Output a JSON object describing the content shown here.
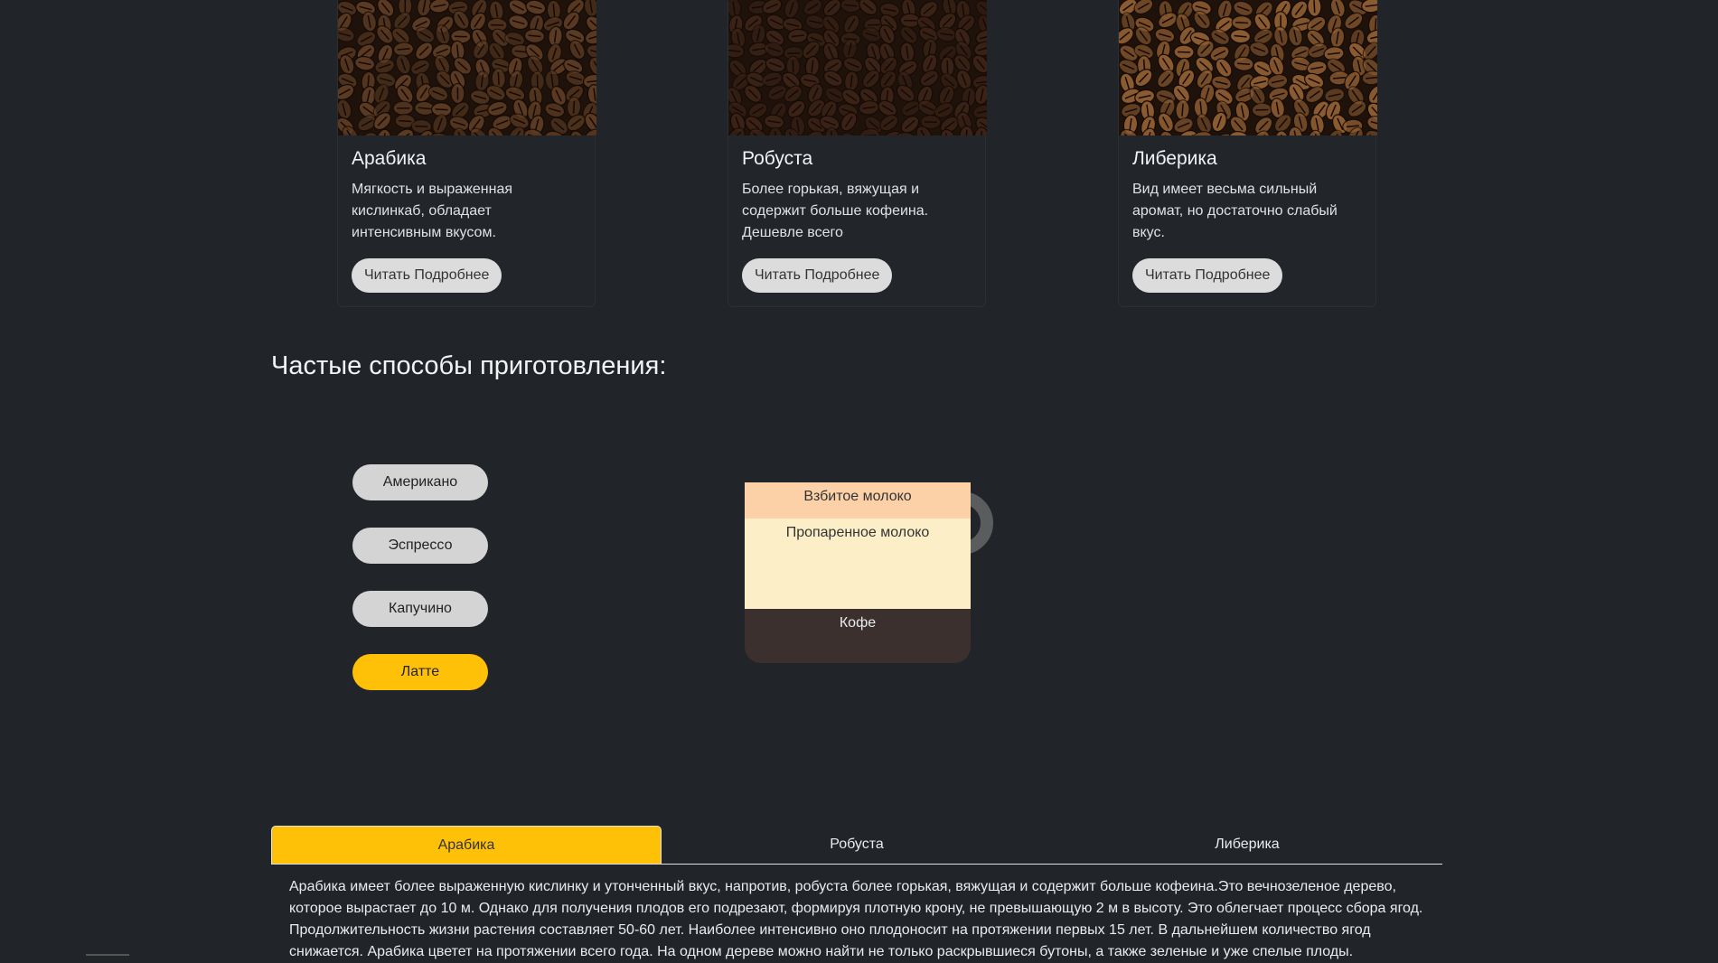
{
  "cards": [
    {
      "title": "Арабика",
      "text": "Мягкость и выраженная кислинкаб, обладает интенсивным вкусом.",
      "button": "Читать Подробнее",
      "image": "arabica-beans-image",
      "color": "#5a3a22"
    },
    {
      "title": "Робуста",
      "text": "Более горькая, вяжущая и содержит больше кофеина. Дешевле всего",
      "button": "Читать Подробнее",
      "image": "robusta-beans-image",
      "color": "#3a2216"
    },
    {
      "title": "Либерика",
      "text": "Вид имеет весьма сильный аромат, но достаточно слабый вкус.",
      "button": "Читать Подробнее",
      "image": "liberica-beans-image",
      "color": "#8a5a30"
    }
  ],
  "heading": "Частые способы приготовления:",
  "methods": [
    {
      "label": "Американо",
      "active": false
    },
    {
      "label": "Эспрессо",
      "active": false
    },
    {
      "label": "Капучино",
      "active": false
    },
    {
      "label": "Латте",
      "active": true
    }
  ],
  "cup": {
    "layers": [
      {
        "label": "Взбитое молоко",
        "color": "#fdd1a8",
        "text_color": "#333333"
      },
      {
        "label": "Пропаренное молоко",
        "color": "#fcefc8",
        "text_color": "#333333"
      },
      {
        "label": "Кофе",
        "color": "#3b302d",
        "text_color": "#e9ecef"
      }
    ]
  },
  "tabs": [
    {
      "label": "Арабика",
      "active": true
    },
    {
      "label": "Робуста",
      "active": false
    },
    {
      "label": "Либерика",
      "active": false
    }
  ],
  "tab_content": "Арабика имеет более выраженную кислинку и утонченный вкус, напротив, робуста более горькая, вяжущая и содержит больше кофеина.Это вечнозеленое дерево, которое вырастает до 10 м. Однако для получения плодов его подрезают, формируя плотную крону, не превышающую 2 м в высоту. Это облегчает процесс сбора ягод. Продолжительность жизни растения составляет 50-60 лет. Наиболее интенсивно оно плодоносит на протяжении первых 15 лет. В дальнейшем количество ягод снижается. Арабика цветет на протяжении всего года. На одном дереве можно найти не только раскрывшиеся бутоны, а также зеленые и уже спелые плоды.",
  "colors": {
    "background": "#212529",
    "accent": "#ffc107",
    "button": "#dcdcdc"
  }
}
